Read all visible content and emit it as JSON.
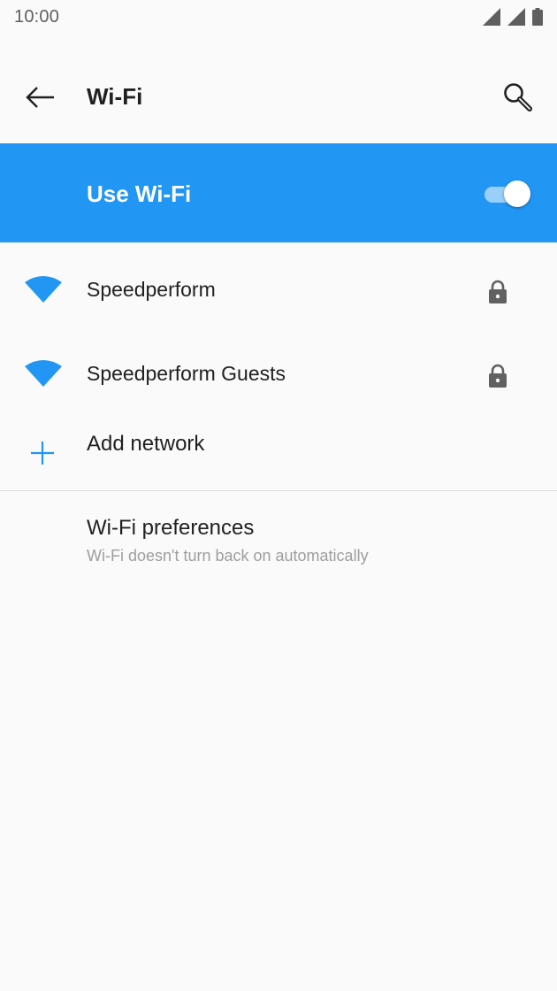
{
  "status_bar": {
    "time": "10:00"
  },
  "app_bar": {
    "title": "Wi-Fi",
    "back_icon": "arrow-back-icon",
    "search_icon": "search-icon"
  },
  "master_switch": {
    "label": "Use Wi-Fi",
    "enabled": true,
    "color": "#2196f3"
  },
  "networks": [
    {
      "ssid": "Speedperform",
      "secured": true,
      "icon": "wifi-icon"
    },
    {
      "ssid": "Speedperform Guests",
      "secured": true,
      "icon": "wifi-icon"
    }
  ],
  "add_network": {
    "label": "Add network",
    "icon": "plus-icon"
  },
  "preferences": {
    "title": "Wi-Fi preferences",
    "subtitle": "Wi-Fi doesn't turn back on automatically"
  },
  "colors": {
    "accent": "#2196f3",
    "background": "#fafafa",
    "text_primary": "#212121",
    "text_secondary": "#9e9e9e"
  }
}
